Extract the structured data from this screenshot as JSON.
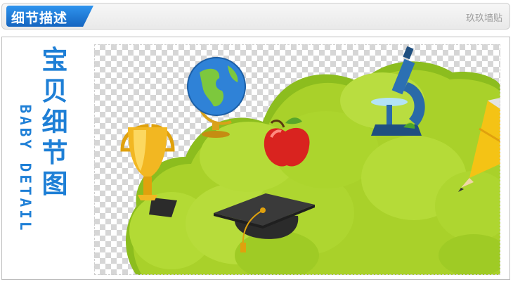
{
  "header": {
    "title": "细节描述",
    "shop_name": "玖玖墙贴"
  },
  "side_label": {
    "chinese_chars": [
      "宝",
      "贝",
      "细",
      "节",
      "图"
    ],
    "english": "BABY DETAIL"
  },
  "colors": {
    "accent_blue": "#1e7fd6",
    "tree_green": "#a9d12a",
    "trunk_brown": "#8a4a1f"
  },
  "icons": [
    "trophy-icon",
    "globe-icon",
    "apple-icon",
    "graduation-cap-icon",
    "microscope-icon",
    "pencil-icon"
  ]
}
